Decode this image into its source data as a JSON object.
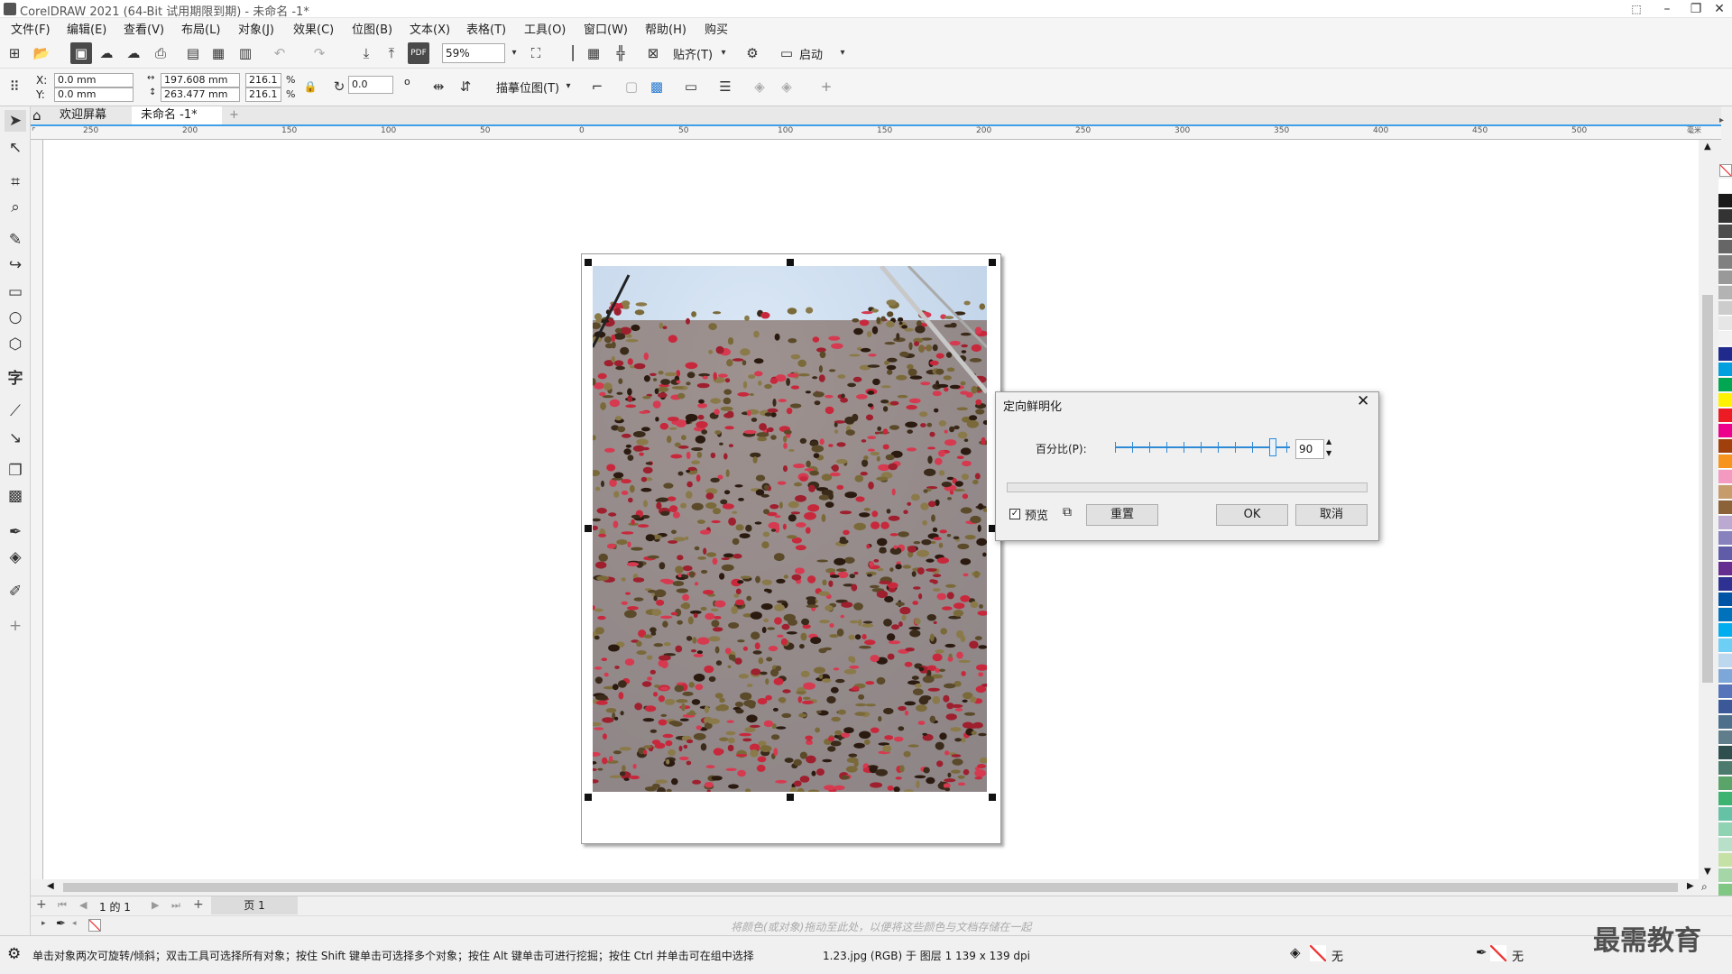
{
  "window": {
    "title": "CorelDRAW 2021 (64-Bit 试用期限到期) - 未命名 -1*",
    "minimize": "–",
    "restore": "❐",
    "close": "✕"
  },
  "menu": [
    "文件(F)",
    "编辑(E)",
    "查看(V)",
    "布局(L)",
    "对象(J)",
    "效果(C)",
    "位图(B)",
    "文本(X)",
    "表格(T)",
    "工具(O)",
    "窗口(W)",
    "帮助(H)",
    "购买"
  ],
  "toolbar": {
    "zoom_value": "59%",
    "snap_label": "贴齐(T)",
    "launch_label": "启动"
  },
  "props": {
    "x_label": "X:",
    "y_label": "Y:",
    "x_value": "0.0 mm",
    "y_value": "0.0 mm",
    "width_value": "197.608 mm",
    "height_value": "263.477 mm",
    "scale_w": "216.1",
    "scale_h": "216.1",
    "percent": "%",
    "rotation": "0.0",
    "degree": "o",
    "trace_label": "描摹位图(T)"
  },
  "tabs": {
    "welcome": "欢迎屏幕",
    "document": "未命名 -1*",
    "add": "+"
  },
  "ruler_h": [
    "250",
    "200",
    "150",
    "100",
    "50",
    "0",
    "50",
    "100",
    "150",
    "200",
    "250",
    "300",
    "350",
    "400",
    "450",
    "500"
  ],
  "ruler_unit": "毫米",
  "dialog": {
    "title": "定向鲜明化",
    "percent_label": "百分比(P):",
    "percent_value": "90",
    "percent_level": 0.9,
    "preview_label": "预览",
    "preview_checked": true,
    "reset_label": "重置",
    "ok_label": "OK",
    "cancel_label": "取消"
  },
  "pagenav": {
    "page_of": "1 的 1",
    "page_tab": "页 1"
  },
  "colorbar_hint": "将颜色(或对象)拖动至此处，以便将这些颜色与文档存储在一起",
  "status": {
    "hint": "单击对象两次可旋转/倾斜；双击工具可选择所有对象；按住 Shift 键单击可选择多个对象；按住 Alt 键单击可进行挖掘；按住 Ctrl 并单击可在组中选择",
    "object_info": "1.23.jpg (RGB) 于 图层 1 139 x 139 dpi",
    "fill_label": "无",
    "outline_label": "无"
  },
  "watermark": "最需教育",
  "palette_colors": [
    "#ffffff",
    "#1a1a1a",
    "#333333",
    "#4d4d4d",
    "#666666",
    "#808080",
    "#999999",
    "#b3b3b3",
    "#cccccc",
    "#e6e6e6",
    "#f2f2f2",
    "#1f2a8c",
    "#00a0e0",
    "#00a651",
    "#fff200",
    "#ed1c24",
    "#ec008c",
    "#a0410d",
    "#f7941d",
    "#f49ac1",
    "#c69c6d",
    "#8c6239",
    "#bca9d2",
    "#8781bd",
    "#605ca8",
    "#662d91",
    "#2e3192",
    "#0054a6",
    "#0072bc",
    "#00aeef",
    "#6dcff6",
    "#bdd7ee",
    "#7da7d9",
    "#5674b9",
    "#3b5998",
    "#4d6f8c",
    "#607d8b",
    "#2f4f4f",
    "#4c7a6e",
    "#5aa469",
    "#3cb371",
    "#66c2a5",
    "#8fd3b3",
    "#b8e0c8",
    "#c5e1a5",
    "#a5d6a7",
    "#81c784"
  ]
}
